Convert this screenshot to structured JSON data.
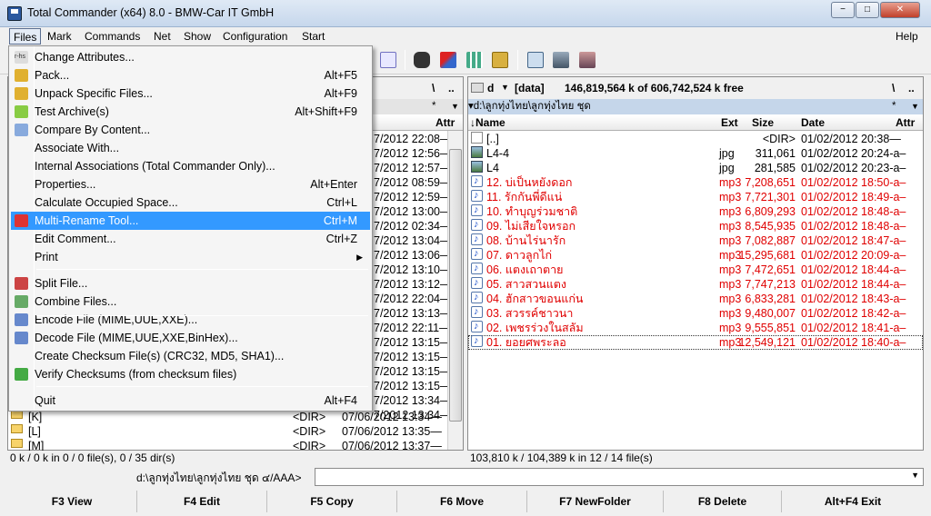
{
  "window": {
    "title": "Total Commander (x64) 8.0 - BMW-Car IT GmbH",
    "min": "−",
    "max": "□",
    "close": "✕",
    "min_icon": "minimize-icon",
    "close_icon": "close-icon"
  },
  "menu": [
    "Files",
    "Mark",
    "Commands",
    "Net",
    "Show",
    "Configuration",
    "Start"
  ],
  "help": "Help",
  "files_menu": {
    "items": [
      {
        "label": "Change Attributes...",
        "shortcut": "",
        "icon": "attributes-icon",
        "icon_label": "r-hs"
      },
      {
        "label": "Pack...",
        "shortcut": "Alt+F5",
        "icon": "pack-icon"
      },
      {
        "label": "Unpack Specific Files...",
        "shortcut": "Alt+F9",
        "icon": "unpack-icon"
      },
      {
        "label": "Test Archive(s)",
        "shortcut": "Alt+Shift+F9",
        "icon": "test-archive-icon"
      },
      {
        "label": "Compare By Content...",
        "shortcut": "",
        "icon": "compare-icon"
      },
      {
        "label": "Associate With...",
        "shortcut": ""
      },
      {
        "label": "Internal Associations (Total Commander Only)...",
        "shortcut": ""
      },
      {
        "label": "Properties...",
        "shortcut": "Alt+Enter"
      },
      {
        "label": "Calculate Occupied Space...",
        "shortcut": "Ctrl+L"
      },
      {
        "label": "Multi-Rename Tool...",
        "shortcut": "Ctrl+M",
        "icon": "multi-rename-icon"
      },
      {
        "label": "Edit Comment...",
        "shortcut": "Ctrl+Z"
      },
      {
        "label": "Print",
        "shortcut": "",
        "submenu_icon": "submenu-arrow-icon"
      },
      {
        "label": "Split File...",
        "shortcut": "",
        "icon": "split-icon"
      },
      {
        "label": "Combine Files...",
        "shortcut": "",
        "icon": "combine-icon"
      },
      {
        "label": "Encode File  (MIME,UUE,XXE)...",
        "shortcut": "",
        "icon": "encode-icon"
      },
      {
        "label": "Decode File  (MIME,UUE,XXE,BinHex)...",
        "shortcut": "",
        "icon": "decode-icon"
      },
      {
        "label": "Create Checksum File(s) (CRC32, MD5, SHA1)...",
        "shortcut": ""
      },
      {
        "label": "Verify Checksums (from checksum files)",
        "shortcut": "",
        "icon": "verify-icon"
      },
      {
        "label": "Quit",
        "shortcut": "Alt+F4"
      }
    ],
    "highlighted": "Multi-Rename Tool..."
  },
  "left_panel": {
    "sort_btn": "\\",
    "up_btn": "..",
    "filter": "*",
    "dropdown_arrow": "▼",
    "col_attr": "Attr",
    "date_rows": [
      "7/2012 22:08—",
      "7/2012 12:56—",
      "7/2012 12:57—",
      "7/2012 08:59—",
      "7/2012 12:59—",
      "7/2012 13:00—",
      "7/2012 02:34—",
      "7/2012 13:04—",
      "7/2012 13:06—",
      "7/2012 13:10—",
      "7/2012 13:12—",
      "7/2012 22:04—",
      "7/2012 13:13—",
      "7/2012 22:11—",
      "7/2012 13:15—",
      "7/2012 13:15—",
      "7/2012 13:15—",
      "7/2012 13:15—",
      "7/2012 13:34—",
      "7/2012 13:34—"
    ],
    "dirs": [
      {
        "name": "[K]",
        "size": "<DIR>",
        "date": "07/06/2012 13:34—"
      },
      {
        "name": "[L]",
        "size": "<DIR>",
        "date": "07/06/2012 13:35—"
      },
      {
        "name": "[M]",
        "size": "<DIR>",
        "date": "07/06/2012 13:37—"
      }
    ],
    "status": "0 k / 0 k in 0 / 0 file(s), 0 / 35 dir(s)"
  },
  "right_panel": {
    "drive": "d",
    "label": "[data]",
    "free": "146,819,564 k of 606,742,524 k free",
    "sort_btn": "\\",
    "up_btn": "..",
    "filter": "*",
    "dropdown_arrow": "▼",
    "path": "▾d:\\ลูกทุ่งไทย\\ลูกทุ่งไทย ชุด",
    "columns": {
      "name": "↓Name",
      "ext": "Ext",
      "size": "Size",
      "date": "Date",
      "attr": "Attr"
    },
    "files": [
      {
        "name": "[..]",
        "ext": "",
        "size": "<DIR>",
        "date": "01/02/2012 20:38—",
        "red": false,
        "icon": "up-dir-icon"
      },
      {
        "name": "L4-4",
        "ext": "jpg",
        "size": "311,061",
        "date": "01/02/2012 20:24-a–",
        "red": false,
        "icon": "image-file-icon"
      },
      {
        "name": "L4",
        "ext": "jpg",
        "size": "281,585",
        "date": "01/02/2012 20:23-a–",
        "red": false,
        "icon": "image-file-icon"
      },
      {
        "name": "12. บ่เป็นหยังดอก",
        "ext": "mp3",
        "size": "7,208,651",
        "date": "01/02/2012 18:50-a–",
        "red": true,
        "icon": "audio-file-icon"
      },
      {
        "name": "11. รักกันพี่ดีแน่",
        "ext": "mp3",
        "size": "7,721,301",
        "date": "01/02/2012 18:49-a–",
        "red": true,
        "icon": "audio-file-icon"
      },
      {
        "name": "10. ทำบุญร่วมชาติ",
        "ext": "mp3",
        "size": "6,809,293",
        "date": "01/02/2012 18:48-a–",
        "red": true,
        "icon": "audio-file-icon"
      },
      {
        "name": "09. ไม่เสียใจหรอก",
        "ext": "mp3",
        "size": "8,545,935",
        "date": "01/02/2012 18:48-a–",
        "red": true,
        "icon": "audio-file-icon"
      },
      {
        "name": "08. บ้านไร่นารัก",
        "ext": "mp3",
        "size": "7,082,887",
        "date": "01/02/2012 18:47-a–",
        "red": true,
        "icon": "audio-file-icon"
      },
      {
        "name": "07. ดาวลูกไก่",
        "ext": "mp3",
        "size": "15,295,681",
        "date": "01/02/2012 20:09-a–",
        "red": true,
        "icon": "audio-file-icon"
      },
      {
        "name": "06. แตงเถาตาย",
        "ext": "mp3",
        "size": "7,472,651",
        "date": "01/02/2012 18:44-a–",
        "red": true,
        "icon": "audio-file-icon"
      },
      {
        "name": "05. สาวสวนแตง",
        "ext": "mp3",
        "size": "7,747,213",
        "date": "01/02/2012 18:44-a–",
        "red": true,
        "icon": "audio-file-icon"
      },
      {
        "name": "04. ฮักสาวขอนแก่น",
        "ext": "mp3",
        "size": "6,833,281",
        "date": "01/02/2012 18:43-a–",
        "red": true,
        "icon": "audio-file-icon"
      },
      {
        "name": "03. สวรรค์ชาวนา",
        "ext": "mp3",
        "size": "9,480,007",
        "date": "01/02/2012 18:42-a–",
        "red": true,
        "icon": "audio-file-icon"
      },
      {
        "name": "02. เพชรร่วงในสลัม",
        "ext": "mp3",
        "size": "9,555,851",
        "date": "01/02/2012 18:41-a–",
        "red": true,
        "icon": "audio-file-icon"
      },
      {
        "name": "01. ยอยศพระลอ",
        "ext": "mp3",
        "size": "12,549,121",
        "date": "01/02/2012 18:40-a–",
        "red": true,
        "icon": "audio-file-icon"
      }
    ],
    "status": "103,810 k / 104,389 k in 12 / 14 file(s)"
  },
  "cmdline": {
    "path": "d:\\ลูกทุ่งไทย\\ลูกทุ่งไทย ชุด ๔/AAA>",
    "value": ""
  },
  "fkeys": [
    "F3 View",
    "F4 Edit",
    "F5 Copy",
    "F6 Move",
    "F7 NewFolder",
    "F8 Delete",
    "Alt+F4 Exit"
  ],
  "colors": {
    "selected": "#3399ff",
    "red_file": "#e00000",
    "path_bar": "#c5d6ea"
  }
}
